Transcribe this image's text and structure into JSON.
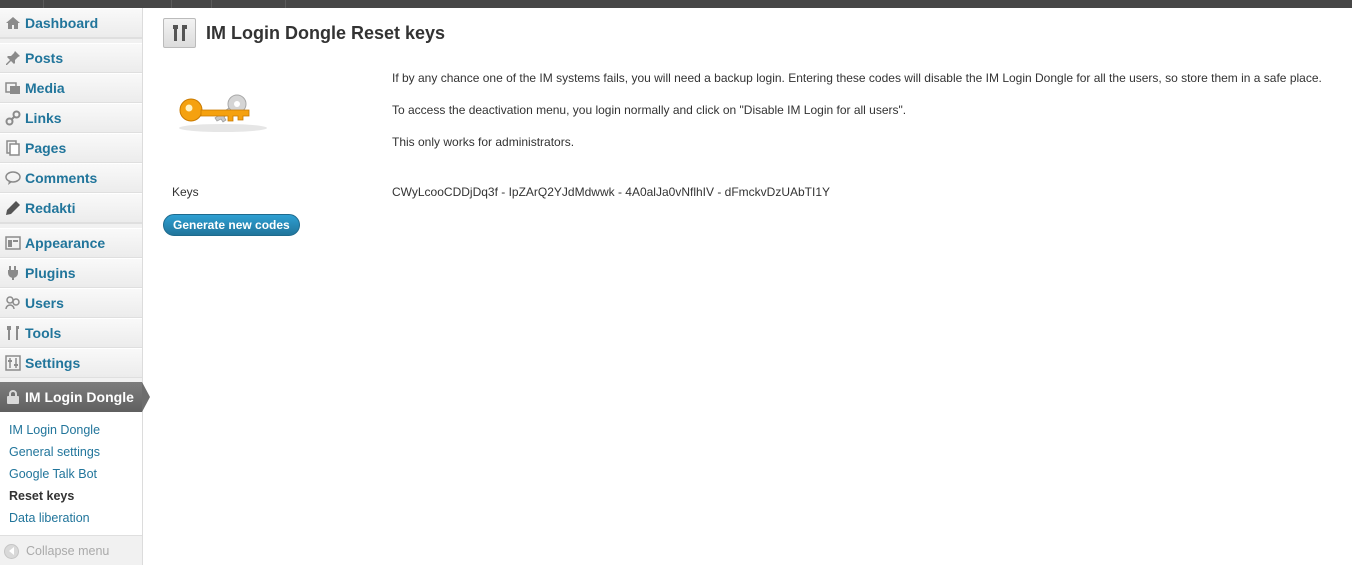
{
  "sidebar": {
    "items": [
      {
        "label": "Dashboard",
        "icon": "dashboard-icon"
      },
      {
        "label": "Posts",
        "icon": "pin-icon"
      },
      {
        "label": "Media",
        "icon": "media-icon"
      },
      {
        "label": "Links",
        "icon": "link-icon"
      },
      {
        "label": "Pages",
        "icon": "pages-icon"
      },
      {
        "label": "Comments",
        "icon": "comment-icon"
      },
      {
        "label": "Redakti",
        "icon": "pencil-icon"
      },
      {
        "label": "Appearance",
        "icon": "appearance-icon"
      },
      {
        "label": "Plugins",
        "icon": "plug-icon"
      },
      {
        "label": "Users",
        "icon": "users-icon"
      },
      {
        "label": "Tools",
        "icon": "tools-icon"
      },
      {
        "label": "Settings",
        "icon": "settings-icon"
      }
    ],
    "current": {
      "label": "IM Login Dongle",
      "icon": "lock-icon"
    },
    "submenu": [
      {
        "label": "IM Login Dongle"
      },
      {
        "label": "General settings"
      },
      {
        "label": "Google Talk Bot"
      },
      {
        "label": "Reset keys"
      },
      {
        "label": "Data liberation"
      }
    ],
    "collapse_label": "Collapse menu"
  },
  "main": {
    "title": "IM Login Dongle Reset keys",
    "title_icon": "tools-icon",
    "image_icon": "keys-icon",
    "description": [
      "If by any chance one of the IM systems fails, you will need a backup login. Entering these codes will disable the IM Login Dongle for all the users, so store them in a safe place.",
      "To access the deactivation menu, you login normally and click on \"Disable IM Login for all users\".",
      "This only works for administrators."
    ],
    "keys_label": "Keys",
    "keys_value": "CWyLcooCDDjDq3f - IpZArQ2YJdMdwwk - 4A0alJa0vNflhIV - dFmckvDzUAbTI1Y",
    "generate_button": "Generate new codes"
  },
  "colors": {
    "link": "#21759b",
    "button": "#21759b",
    "current_menu": "#6d6d6d",
    "admin_bar": "#464646"
  }
}
